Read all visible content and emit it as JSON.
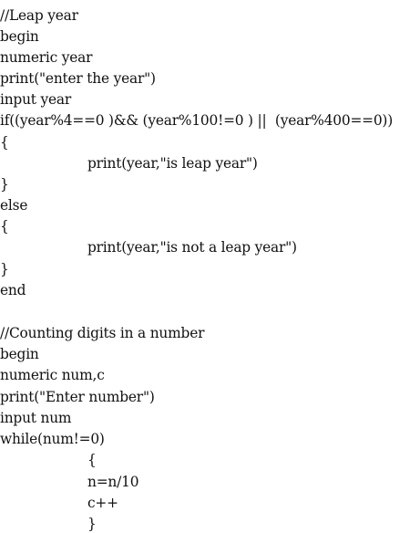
{
  "document": {
    "leap_year": {
      "comment": "//Leap year",
      "begin": "begin",
      "declare": "numeric year",
      "prompt": "print(\"enter the year\")",
      "input": "input year",
      "condition": "if((year%4==0 )&& (year%100!=0 ) ||  (year%400==0))",
      "open_if": "{",
      "print_leap": "print(year,\"is leap year\")",
      "close_if": "}",
      "else": "else",
      "open_else": "{",
      "print_not_leap": "print(year,\"is not a leap year\")",
      "close_else": "}",
      "end": "end"
    },
    "count_digits": {
      "comment": "//Counting digits in a number",
      "begin": "begin",
      "declare": "numeric num,c",
      "prompt": "print(\"Enter number\")",
      "input": "input num",
      "loop": "while(num!=0)",
      "open_loop": "{",
      "divide": "n=n/10",
      "increment": "c++",
      "close_loop": "}"
    }
  }
}
